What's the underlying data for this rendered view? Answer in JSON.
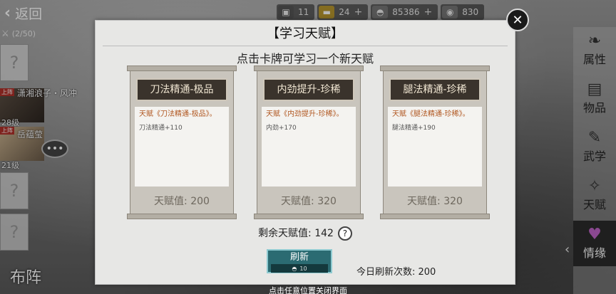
{
  "topbar": {
    "back_label": "返回",
    "resources": [
      {
        "icon": "cart-icon",
        "value": "11",
        "icon_color": "#555555"
      },
      {
        "icon": "gold-bar-icon",
        "value": "24",
        "icon_color": "#b8962e"
      },
      {
        "icon": "silver-ingot-icon",
        "value": "85386",
        "icon_color": "#777777"
      },
      {
        "icon": "coin-icon",
        "value": "830",
        "icon_color": "#777777"
      }
    ]
  },
  "team": {
    "slot_count": "(2/50)",
    "members": [
      {
        "tag": "上阵",
        "name": "潇湘浪子・风冲",
        "level": "28级"
      },
      {
        "tag": "上阵",
        "name": "岳蕴莹",
        "level": "21级"
      }
    ],
    "empty_slot_symbol": "?",
    "formation_label": "布阵"
  },
  "side_tabs": [
    {
      "icon": "scroll-icon",
      "label": "属性"
    },
    {
      "icon": "bag-icon",
      "label": "物品"
    },
    {
      "icon": "book-icon",
      "label": "武学"
    },
    {
      "icon": "talent-icon",
      "label": "天赋"
    },
    {
      "icon": "heart-icon",
      "label": "情缘"
    }
  ],
  "dialog": {
    "title": "【学习天赋】",
    "subtitle": "点击卡牌可学习一个新天赋",
    "cards": [
      {
        "name": "刀法精通-极品",
        "talent": "天赋《刀法精通-极品》。",
        "effect": "刀法精通+110",
        "value": "天赋值: 200"
      },
      {
        "name": "内劲提升-珍稀",
        "talent": "天赋《内劲提升-珍稀》。",
        "effect": "内劲+170",
        "value": "天赋值: 320"
      },
      {
        "name": "腿法精通-珍稀",
        "talent": "天赋《腿法精通-珍稀》。",
        "effect": "腿法精通+190",
        "value": "天赋值: 320"
      }
    ],
    "remaining_label": "剩余天赋值: 142",
    "refresh_label": "刷新",
    "refresh_cost": "10",
    "refresh_count_label": "今日刷新次数: 200",
    "close_hint": "点击任意位置关闭界面"
  },
  "colors": {
    "accent_teal": "#2b6b72",
    "talent_text": "#b0561f",
    "active_tab_icon": "#c065c8"
  }
}
